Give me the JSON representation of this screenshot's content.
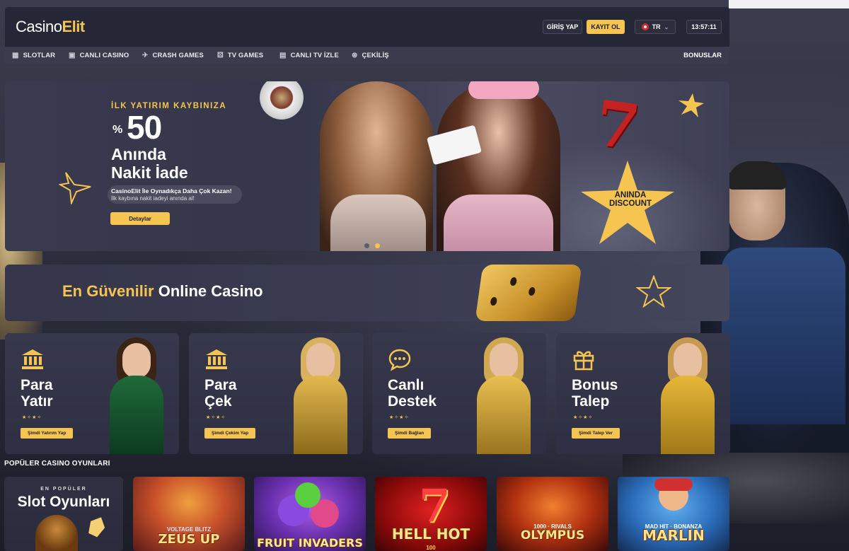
{
  "header": {
    "logo_main": "Casino",
    "logo_accent": "Elit",
    "login_label": "GİRİŞ YAP",
    "register_label": "KAYIT OL",
    "language": "TR",
    "clock": "13:57:11"
  },
  "nav": {
    "items": [
      {
        "label": "SLOTLAR",
        "icon": "slot-icon"
      },
      {
        "label": "CANLI CASINO",
        "icon": "cards-icon"
      },
      {
        "label": "CRASH GAMES",
        "icon": "plane-icon"
      },
      {
        "label": "TV GAMES",
        "icon": "dice-icon"
      },
      {
        "label": "CANLI TV İZLE",
        "icon": "tv-icon"
      },
      {
        "label": "ÇEKİLİŞ",
        "icon": "gift-icon"
      }
    ],
    "bonus_label": "BONUSLAR"
  },
  "hero": {
    "kicker": "İLK YATIRIM KAYBINIZA",
    "pct_symbol": "%",
    "pct_value": "50",
    "line1": "Anında",
    "line2": "Nakit İade",
    "sub1": "CasinoElit İle Oynadıkça Daha Çok Kazan!",
    "sub2": "İlk kaybına nakit iadeyi anında al!",
    "button": "Detaylar",
    "badge_line1": "ANINDA",
    "badge_line2": "DISCOUNT",
    "slides": 2,
    "active_slide": 2
  },
  "tagline": {
    "gold": "En Güvenilir",
    "white": " Online Casino"
  },
  "actions": [
    {
      "line1": "Para",
      "line2": "Yatır",
      "button": "Şimdi Yatırım Yap",
      "icon": "bank-icon"
    },
    {
      "line1": "Para",
      "line2": "Çek",
      "button": "Şimdi Çekim Yap",
      "icon": "bank-icon"
    },
    {
      "line1": "Canlı",
      "line2": "Destek",
      "button": "Şimdi Bağlan",
      "icon": "chat-icon"
    },
    {
      "line1": "Bonus",
      "line2": "Talep",
      "button": "Şimdi Talep Ver",
      "icon": "gift-icon"
    }
  ],
  "section": {
    "title": "POPÜLER CASINO OYUNLARI"
  },
  "promo": {
    "kicker": "EN POPÜLER",
    "title": "Slot Oyunları"
  },
  "games": [
    {
      "title": "ZEUS UP",
      "sub": "VOLTAGE BLITZ"
    },
    {
      "title": "FRUIT INVADERS",
      "sub": ""
    },
    {
      "title": "HELL HOT",
      "sub": "100"
    },
    {
      "title": "OLYMPUS",
      "sub": "1000 · RIVALS"
    },
    {
      "title": "MARLIN",
      "sub": "MAD HIT · BONANZA"
    }
  ],
  "colors": {
    "accent": "#f5c451",
    "header_bg": "#262736",
    "nav_bg": "#3a3b4c"
  }
}
